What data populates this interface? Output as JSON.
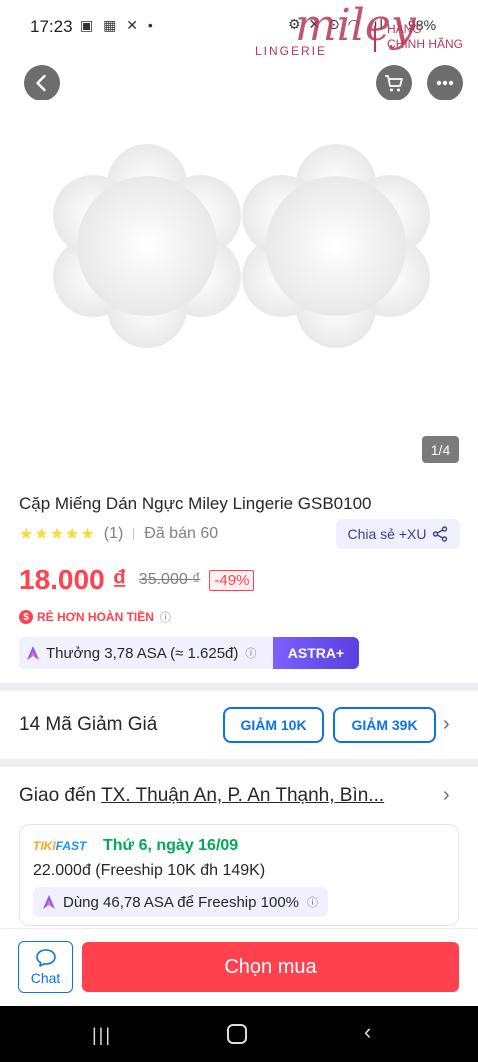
{
  "status_bar": {
    "time": "17:23",
    "icons_left": "▣ ▦ ✕ •",
    "icons_right": "⚙ ✕ ⊙ ◠ .ıl",
    "battery": "98%"
  },
  "brand": {
    "script": "miley",
    "sub": "LINGERIE",
    "tag_line1": "HÀNG",
    "tag_line2": "CHÍNH HÃNG",
    "brand_color": "#b8375a"
  },
  "nav": {
    "back_icon": "chevron-left",
    "cart_icon": "cart",
    "more_icon": "more-horizontal"
  },
  "gallery": {
    "counter": "1/4"
  },
  "product": {
    "title": "Cặp Miếng Dán Ngực Miley Lingerie GSB0100",
    "stars": "★★★★★",
    "rating_count": "(1)",
    "sold": "Đã bán 60",
    "share_label": "Chia sẻ +XU",
    "price": "18.000 ₫",
    "old_price": "35.000 ₫",
    "discount": "-49%",
    "refund_label": "RẺ HƠN HOÀN TIỀN",
    "refund_badge": "$",
    "asa_reward": "Thưởng 3,78 ASA (≈ 1.625đ)",
    "astra_label": "ASTRA+"
  },
  "coupons": {
    "label": "14 Mã Giảm Giá",
    "items": [
      "GIẢM 10K",
      "GIẢM 39K"
    ]
  },
  "shipping": {
    "label": "Giao đến",
    "address": "TX. Thuận An, P. An Thạnh, Bìn...",
    "fast_brand_a": "TIKI",
    "fast_brand_b": "FAST",
    "date": "Thứ 6, ngày 16/09",
    "fee": "22.000đ (Freeship 10K đh 149K)",
    "freeship_asa": "Dùng 46,78 ASA để Freeship 100%"
  },
  "bottom": {
    "chat_label": "Chat",
    "buy_label": "Chọn mua"
  },
  "colors": {
    "accent_red": "#ff424e",
    "accent_blue": "#0b74e5",
    "green": "#00ab56",
    "astra_purple": "#7b61ff"
  }
}
